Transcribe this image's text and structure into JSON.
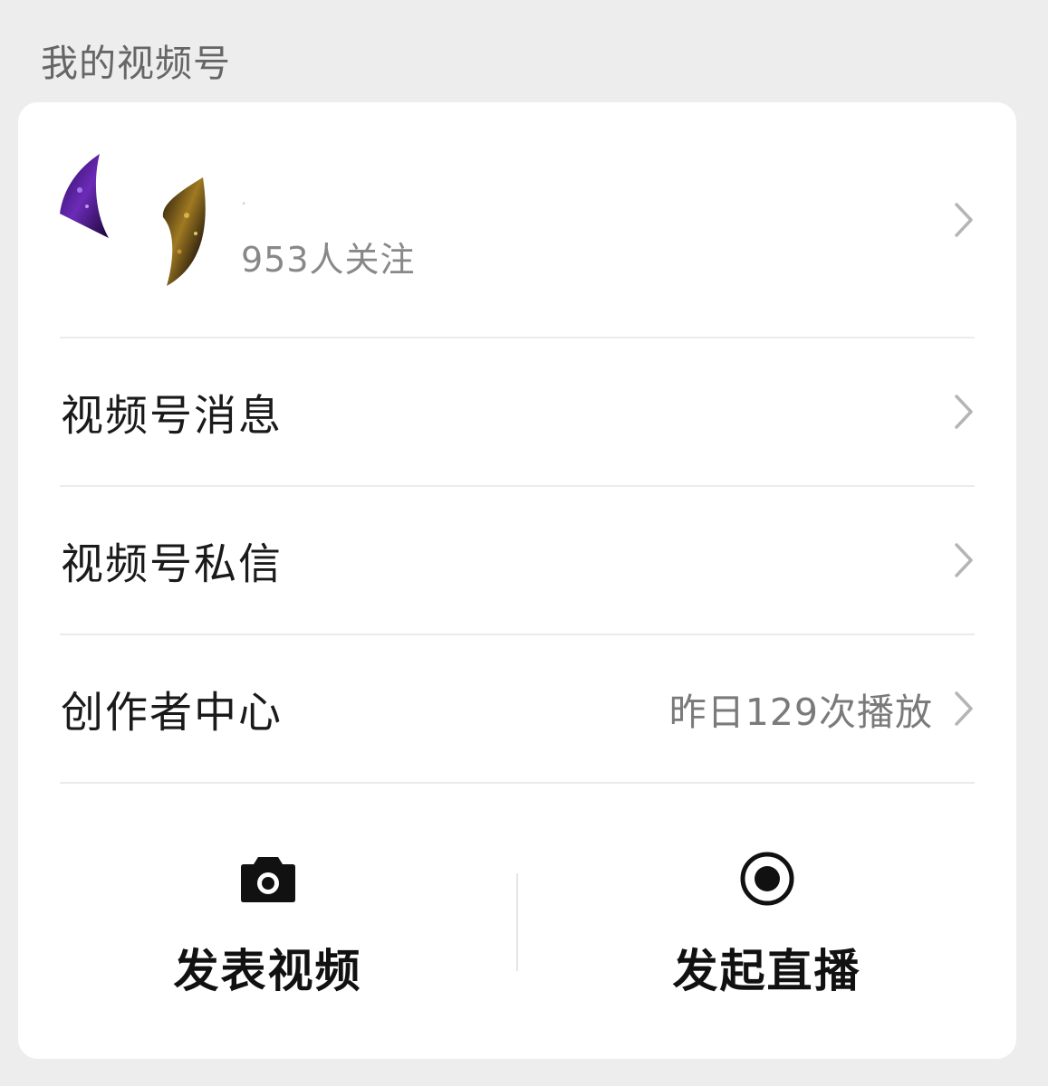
{
  "section": {
    "title": "我的视频号"
  },
  "profile": {
    "name": "·",
    "followers": "953人关注"
  },
  "menu": [
    {
      "label": "视频号消息",
      "value": ""
    },
    {
      "label": "视频号私信",
      "value": ""
    },
    {
      "label": "创作者中心",
      "value": "昨日129次播放"
    }
  ],
  "actions": {
    "publish_video": {
      "label": "发表视频",
      "icon": "camera-icon"
    },
    "start_live": {
      "label": "发起直播",
      "icon": "live-record-icon"
    }
  },
  "colors": {
    "background": "#ededed",
    "card": "#ffffff",
    "secondary_text": "#888888",
    "chevron": "#b5b5b5"
  }
}
